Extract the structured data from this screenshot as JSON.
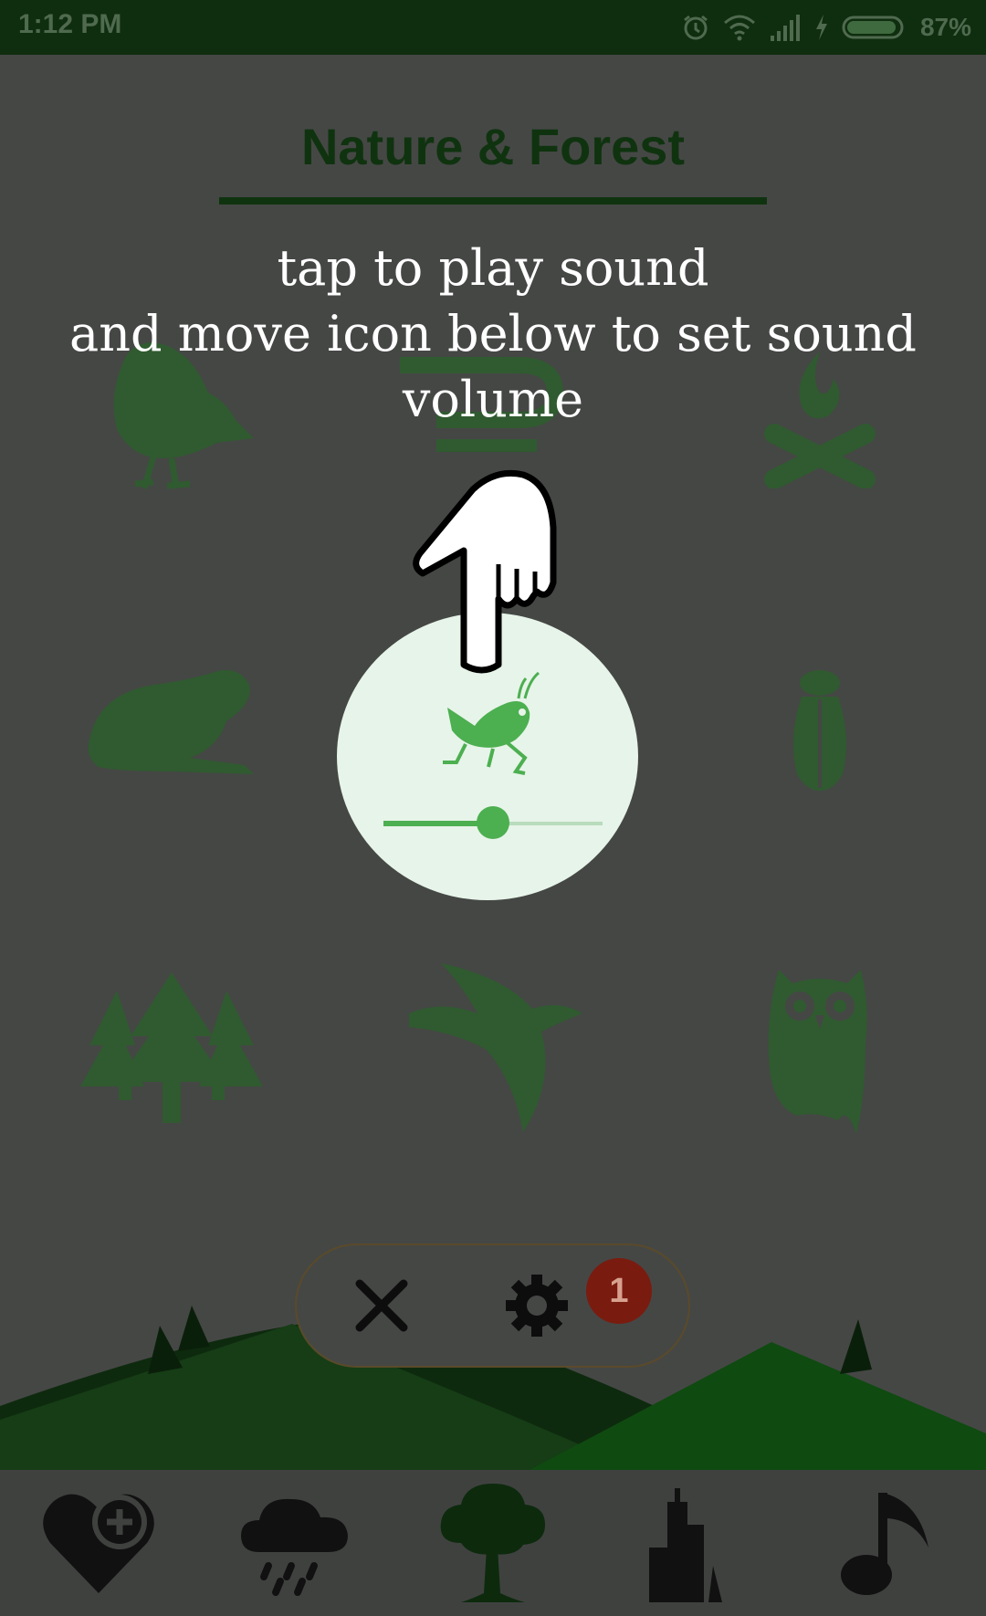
{
  "status_bar": {
    "time": "1:12 PM",
    "battery": "87%",
    "icons": [
      "alarm-icon",
      "wifi-icon",
      "signal-icon",
      "charging-icon",
      "battery-icon"
    ]
  },
  "page": {
    "title": "Nature & Forest"
  },
  "tutorial": {
    "line1": "tap to play sound",
    "line2": "and move icon below to set sound",
    "line3": "volume"
  },
  "sound_tiles": [
    {
      "icon": "bird-icon"
    },
    {
      "icon": "stream-icon"
    },
    {
      "icon": "campfire-icon"
    },
    {
      "icon": "frog-icon"
    },
    {
      "icon": "grasshopper-icon"
    },
    {
      "icon": "cicada-icon"
    },
    {
      "icon": "pine-trees-icon"
    },
    {
      "icon": "seagull-icon"
    },
    {
      "icon": "owl-icon"
    }
  ],
  "highlighted_sound": {
    "icon": "grasshopper-icon",
    "volume_fraction": 0.5
  },
  "action_pill": {
    "close_icon": "close-icon",
    "settings_icon": "gear-icon",
    "badge_count": "1"
  },
  "bottom_nav": [
    {
      "icon": "favorite-add-icon"
    },
    {
      "icon": "rain-icon"
    },
    {
      "icon": "tree-icon",
      "active": true
    },
    {
      "icon": "city-icon"
    },
    {
      "icon": "music-note-icon"
    }
  ],
  "colors": {
    "status_bar": "#0f2d0f",
    "overlay": "#454745",
    "title": "#0f330f",
    "accent_green": "#4caf50",
    "highlight_circle": "#e7f4e9",
    "badge": "#7a1b0f"
  }
}
